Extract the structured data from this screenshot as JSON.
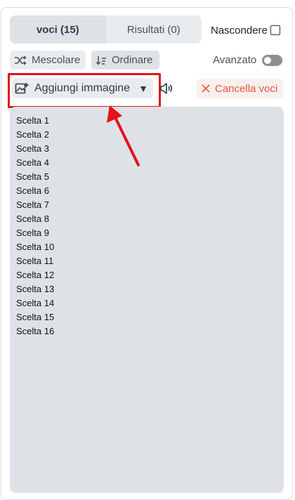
{
  "tabs": {
    "entries_label": "voci (15)",
    "results_label": "Risultati (0)"
  },
  "hide": {
    "label": "Nascondere",
    "checked": false
  },
  "toolbar": {
    "shuffle_label": "Mescolare",
    "sort_label": "Ordinare",
    "advanced_label": "Avanzato",
    "advanced_on": false
  },
  "actions": {
    "add_image_label": "Aggiungi immagine",
    "caret": "▼",
    "clear_label": "Cancella voci"
  },
  "entries": [
    "Scelta 1",
    "Scelta 2",
    "Scelta 3",
    "Scelta 4",
    "Scelta 5",
    "Scelta 6",
    "Scelta 7",
    "Scelta 8",
    "Scelta 9",
    "Scelta 10",
    "Scelta 11",
    "Scelta 12",
    "Scelta 13",
    "Scelta 14",
    "Scelta 15",
    "Scelta 16"
  ],
  "icons": {
    "shuffle": "shuffle-icon",
    "sort": "sort-icon",
    "add_image": "add-image-icon",
    "speaker": "speaker-icon",
    "clear": "close-icon",
    "arrow": "annotation-arrow"
  },
  "colors": {
    "annotation": "#e3131a",
    "clear_text": "#e8553a",
    "entries_bg": "#dee2e6"
  }
}
